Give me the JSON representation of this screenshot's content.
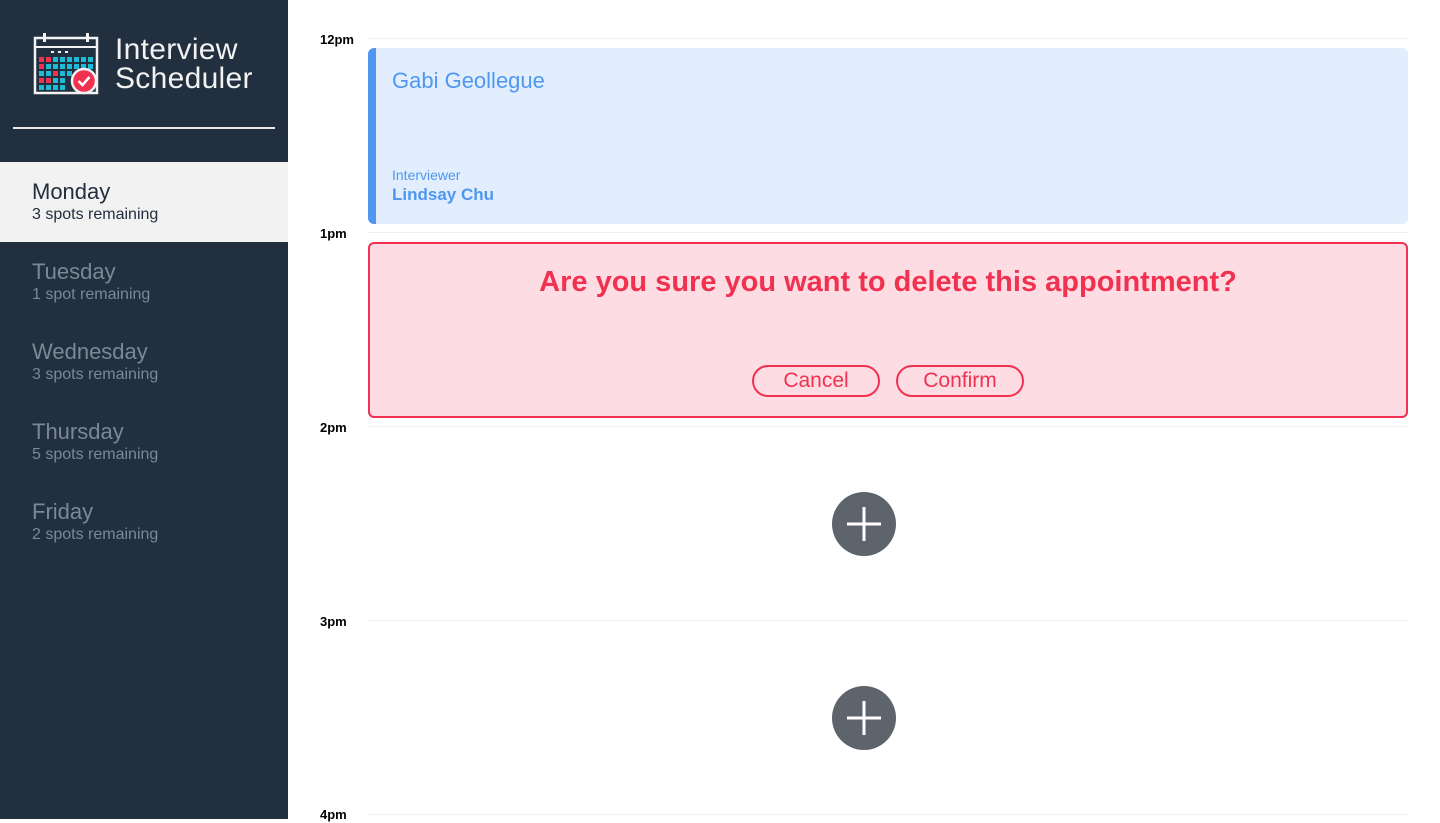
{
  "app": {
    "title_line1": "Interview",
    "title_line2": "Scheduler"
  },
  "days": [
    {
      "name": "Monday",
      "spots": "3 spots remaining",
      "selected": true
    },
    {
      "name": "Tuesday",
      "spots": "1 spot remaining",
      "selected": false
    },
    {
      "name": "Wednesday",
      "spots": "3 spots remaining",
      "selected": false
    },
    {
      "name": "Thursday",
      "spots": "5 spots remaining",
      "selected": false
    },
    {
      "name": "Friday",
      "spots": "2 spots remaining",
      "selected": false
    }
  ],
  "hours": [
    "12pm",
    "1pm",
    "2pm",
    "3pm",
    "4pm"
  ],
  "appointment": {
    "student": "Gabi Geollegue",
    "interviewer_label": "Interviewer",
    "interviewer_name": "Lindsay Chu"
  },
  "confirm": {
    "message": "Are you sure you want to delete this appointment?",
    "cancel_label": "Cancel",
    "confirm_label": "Confirm"
  },
  "icons": {
    "logo": "calendar-check-icon",
    "add": "plus-icon"
  },
  "colors": {
    "sidebar_bg": "#222f3e",
    "selected_day_bg": "#f2f2f2",
    "appointment_accent": "#4f97f0",
    "appointment_bg": "#e2eefd",
    "danger": "#f0314f",
    "danger_bg": "#fddde3",
    "add_button": "#5d646c"
  }
}
